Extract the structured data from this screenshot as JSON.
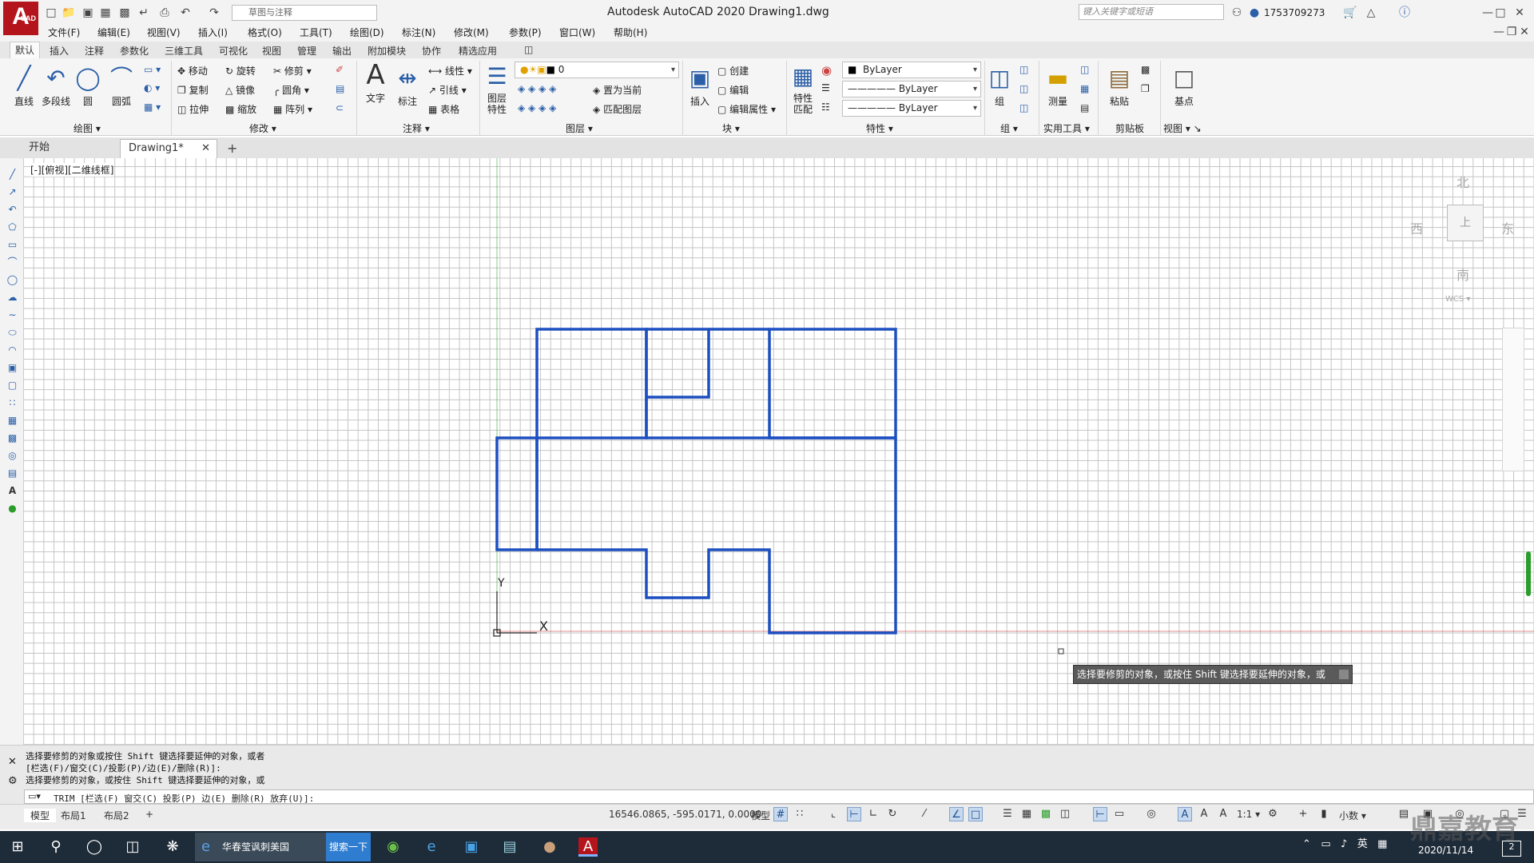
{
  "app": {
    "title": "Autodesk AutoCAD 2020    Drawing1.dwg",
    "logo_letter": "A",
    "logo_sub": "CAD",
    "workspace": "草图与注释",
    "search_placeholder": "键入关键字或短语",
    "user": "1753709273"
  },
  "menus": [
    "文件(F)",
    "编辑(E)",
    "视图(V)",
    "插入(I)",
    "格式(O)",
    "工具(T)",
    "绘图(D)",
    "标注(N)",
    "修改(M)",
    "参数(P)",
    "窗口(W)",
    "帮助(H)"
  ],
  "ribbon_tabs": [
    "默认",
    "插入",
    "注释",
    "参数化",
    "三维工具",
    "可视化",
    "视图",
    "管理",
    "输出",
    "附加模块",
    "协作",
    "精选应用"
  ],
  "ribbon": {
    "draw": {
      "label": "绘图",
      "line": "直线",
      "polyline": "多段线",
      "circle": "圆",
      "arc": "圆弧"
    },
    "modify": {
      "label": "修改",
      "move": "移动",
      "rotate": "旋转",
      "trim": "修剪",
      "copy": "复制",
      "mirror": "镜像",
      "fillet": "圆角",
      "stretch": "拉伸",
      "scale": "缩放",
      "array": "阵列"
    },
    "annotation": {
      "label": "注释",
      "text": "文字",
      "dimension": "标注",
      "linear": "线性",
      "leader": "引线",
      "table": "表格"
    },
    "layers": {
      "label": "图层",
      "layer_props": "图层特性",
      "current_layer": "0",
      "set_current": "置为当前",
      "match_layer": "匹配图层"
    },
    "block": {
      "label": "块",
      "insert": "插入",
      "create": "创建",
      "edit": "编辑",
      "edit_attr": "编辑属性"
    },
    "properties": {
      "label": "特性",
      "match": "特性匹配",
      "color": "ByLayer",
      "linetype": "ByLayer",
      "lineweight": "ByLayer"
    },
    "group": {
      "label": "组",
      "group": "组"
    },
    "utilities": {
      "label": "实用工具",
      "measure": "测量"
    },
    "clipboard": {
      "label": "剪贴板",
      "paste": "粘贴"
    },
    "view": {
      "label": "视图",
      "base": "基点"
    }
  },
  "doc_tabs": {
    "start": "开始",
    "drawing": "Drawing1*"
  },
  "viewport": {
    "label": "[-][俯视][二维线框]",
    "compass": {
      "n": "北",
      "s": "南",
      "e": "东",
      "w": "西",
      "center": "上",
      "wcs": "WCS"
    },
    "ucs": {
      "x": "X",
      "y": "Y"
    },
    "tooltip": "选择要修剪的对象，或按住 Shift 键选择要延伸的对象，或"
  },
  "command": {
    "line1": "选择要修剪的对象或按住 Shift 键选择要延伸的对象，或者",
    "line2": "[栏选(F)/窗交(C)/投影(P)/边(E)/删除(R)]:",
    "line3": "选择要修剪的对象，或按住 Shift 键选择要延伸的对象，或",
    "prompt": "TRIM [栏选(F) 窗交(C) 投影(P) 边(E) 删除(R) 放弃(U)]:"
  },
  "layout_tabs": [
    "模型",
    "布局1",
    "布局2"
  ],
  "status": {
    "coords": "16546.0865, -595.0171, 0.0000",
    "model": "模型",
    "scale": "1:1",
    "units": "小数"
  },
  "taskbar": {
    "task": "华春莹讽刺美国",
    "search_btn": "搜索一下",
    "ime": "英",
    "date": "2020/11/14",
    "notif": "2",
    "watermark": "鼎嘉教育"
  },
  "colors": {
    "geometry": "#1c4fc0",
    "accent": "#b4151c",
    "ucs_y": "#2a9d2a",
    "ucs_x": "#cc3333"
  }
}
